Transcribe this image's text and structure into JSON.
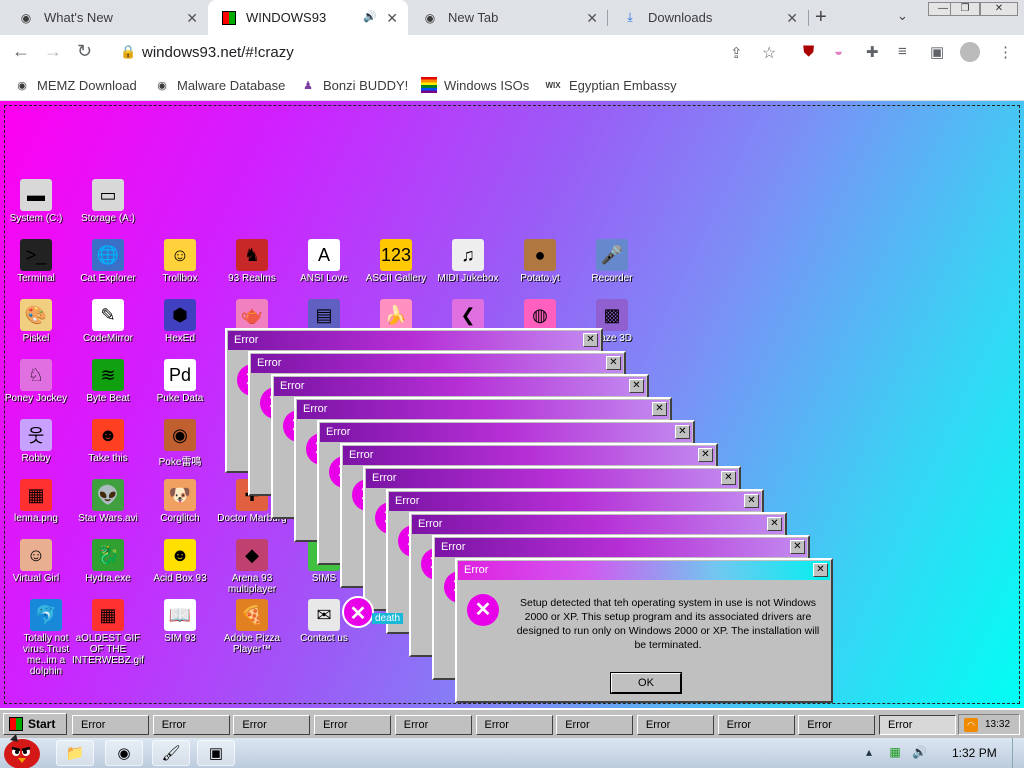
{
  "browser": {
    "tabs": [
      {
        "title": "What's New",
        "icon": "chrome-icon"
      },
      {
        "title": "WINDOWS93",
        "icon": "windows93-icon",
        "audio": "🔊"
      },
      {
        "title": "New Tab",
        "icon": "chrome-icon"
      },
      {
        "title": "Downloads",
        "icon": "download-icon"
      }
    ],
    "new_tab": "+",
    "url": "windows93.net/#!crazy",
    "bookmarks": [
      {
        "label": "MEMZ Download"
      },
      {
        "label": "Malware Database"
      },
      {
        "label": "Bonzi BUDDY!"
      },
      {
        "label": "Windows ISOs"
      },
      {
        "label": "Egyptian Embassy",
        "icon_text": "WIX"
      }
    ]
  },
  "desktop": {
    "icons": [
      {
        "label": "System (C:)",
        "glyph": "▬",
        "color": "#d8d8d8"
      },
      {
        "label": "Storage (A:)",
        "glyph": "▭",
        "color": "#d8d8d8"
      },
      {
        "label": "Terminal",
        "glyph": ">_",
        "color": "#222"
      },
      {
        "label": "Cat Explorer",
        "glyph": "🌐",
        "color": "#3a70c8"
      },
      {
        "label": "Trollbox",
        "glyph": "☺",
        "color": "#ffd23c"
      },
      {
        "label": "93 Realms",
        "glyph": "♞",
        "color": "#c82828"
      },
      {
        "label": "ANSI Love",
        "glyph": "A",
        "color": "#ffffff"
      },
      {
        "label": "ASCII Gallery",
        "glyph": "123",
        "color": "#ffc800"
      },
      {
        "label": "MIDI Jukebox",
        "glyph": "♫",
        "color": "#eeeeee"
      },
      {
        "label": "Potato.yt",
        "glyph": "●",
        "color": "#b07840"
      },
      {
        "label": "Recorder",
        "glyph": "🎤",
        "color": "#6688cc"
      },
      {
        "label": "Piskel",
        "glyph": "🎨",
        "color": "#f0d080"
      },
      {
        "label": "CodeMirror",
        "glyph": "✎",
        "color": "#ffffff"
      },
      {
        "label": "HexEd",
        "glyph": "⬢",
        "color": "#4040c0"
      },
      {
        "label": "Poney Jockey",
        "glyph": "♘",
        "color": "#e070e0"
      },
      {
        "label": "Byte Beat",
        "glyph": "≋",
        "color": "#10a010"
      },
      {
        "label": "Puke Data",
        "glyph": "Pd",
        "color": "#ffffff"
      },
      {
        "label": "Robby",
        "glyph": "웃",
        "color": "#c8a0ff"
      },
      {
        "label": "Take this",
        "glyph": "☻",
        "color": "#ff4020"
      },
      {
        "label": "Poke雷鳴",
        "glyph": "◉",
        "color": "#c06030"
      },
      {
        "label": "lenna.png",
        "glyph": "▦",
        "color": "#ff3030"
      },
      {
        "label": "Star Wars.avi",
        "glyph": "👽",
        "color": "#40a040"
      },
      {
        "label": "Corglitch",
        "glyph": "🐶",
        "color": "#f0a060"
      },
      {
        "label": "Doctor Marburg",
        "glyph": "✚",
        "color": "#e06040"
      },
      {
        "label": "Virtual Girl",
        "glyph": "☺",
        "color": "#e8b090"
      },
      {
        "label": "Hydra.exe",
        "glyph": "🐉",
        "color": "#30a030"
      },
      {
        "label": "Acid Box 93",
        "glyph": "☻",
        "color": "#ffe000"
      },
      {
        "label": "Arena 93 multiplayer",
        "glyph": "◆",
        "color": "#c04070"
      },
      {
        "label": "SIMS",
        "glyph": "◆",
        "color": "#40c040"
      },
      {
        "label": "Totally not virus.Trust me..im a dolphin",
        "glyph": "🐬",
        "color": "#1888d8"
      },
      {
        "label": "aOLDEST GIF OF THE INTERWEBZ.gif",
        "glyph": "▦",
        "color": "#ff3030"
      },
      {
        "label": "SIM 93",
        "glyph": "📖",
        "color": "#ffffff"
      },
      {
        "label": "Adobe Pizza Player™",
        "glyph": "🍕",
        "color": "#e08020"
      },
      {
        "label": "Contact us",
        "glyph": "✉",
        "color": "#e8e8e8"
      },
      {
        "label": "Teapot",
        "glyph": "🫖",
        "color": "#f080c0"
      },
      {
        "label": "Calculator",
        "glyph": "▤",
        "color": "#6060c0"
      },
      {
        "label": "Banana",
        "glyph": "🍌",
        "color": "#ff90c0"
      },
      {
        "label": "File",
        "glyph": "❮",
        "color": "#e070e0"
      },
      {
        "label": "Ball",
        "glyph": "◍",
        "color": "#ff60c0"
      },
      {
        "label": "Maze 3D",
        "glyph": "▩",
        "color": "#9060d0"
      }
    ],
    "death_label": "death",
    "error_windows": [
      {
        "title": "Error"
      },
      {
        "title": "Error"
      },
      {
        "title": "Error"
      },
      {
        "title": "Error"
      },
      {
        "title": "Error"
      },
      {
        "title": "Error"
      },
      {
        "title": "Error"
      },
      {
        "title": "Error"
      },
      {
        "title": "Error"
      },
      {
        "title": "Error"
      }
    ],
    "front_error": {
      "title": "Error",
      "message": "Setup detected that teh operating system in use is not Windows 2000 or XP. This setup program and its associated drivers are designed to run only on Windows 2000 or XP. The installation will be terminated.",
      "ok_label": "OK",
      "close_label": "✕"
    }
  },
  "w93_taskbar": {
    "start_label": "Start",
    "tasks": [
      "Error",
      "Error",
      "Error",
      "Error",
      "Error",
      "Error",
      "Error",
      "Error",
      "Error",
      "Error",
      "Error"
    ],
    "clock": "13:32"
  },
  "win7_taskbar": {
    "clock": "1:32 PM"
  }
}
